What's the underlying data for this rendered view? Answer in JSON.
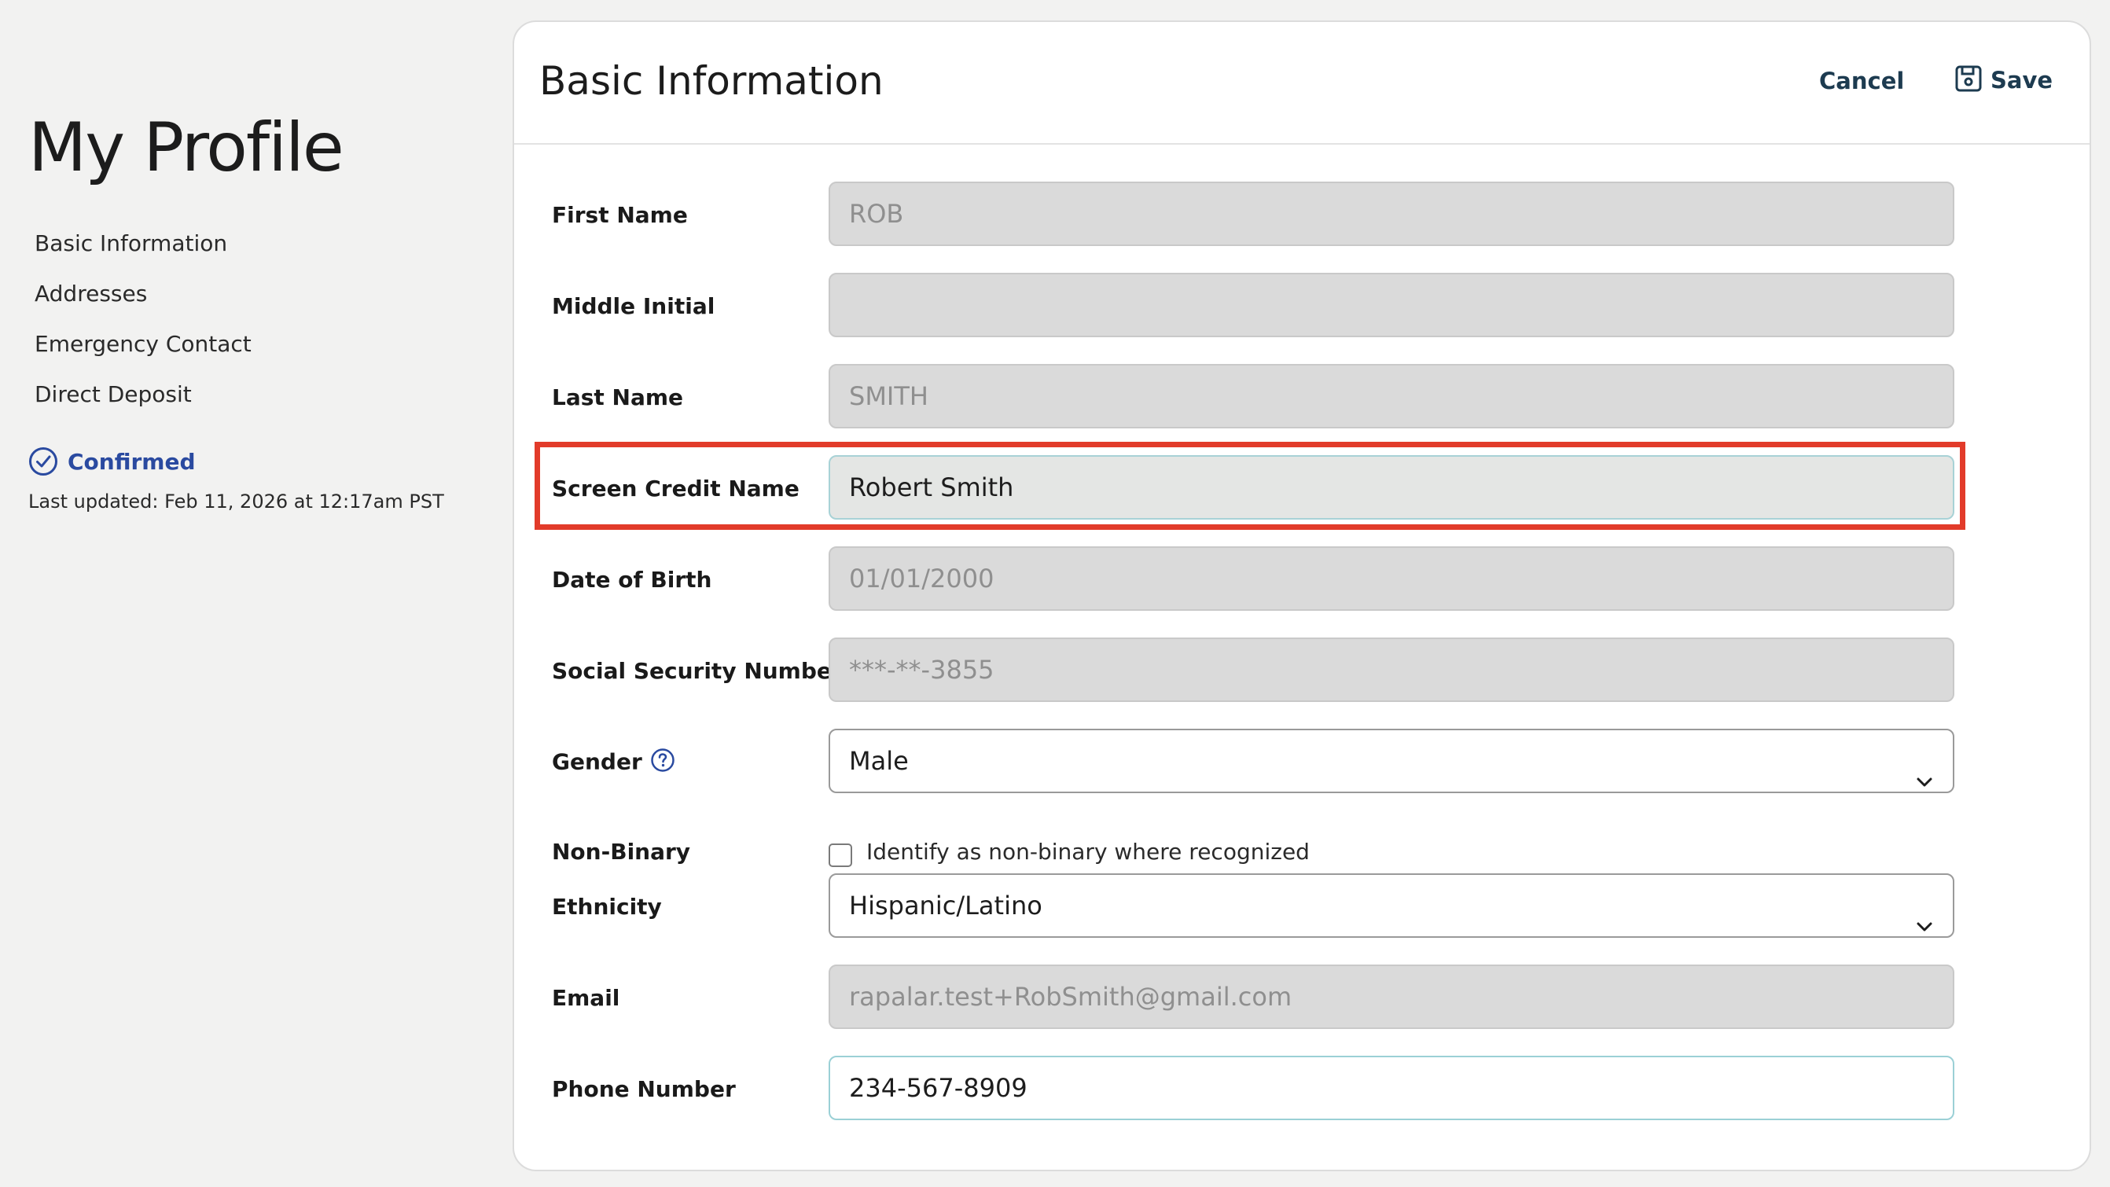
{
  "sidebar": {
    "title": "My Profile",
    "nav": [
      {
        "label": "Basic Information"
      },
      {
        "label": "Addresses"
      },
      {
        "label": "Emergency Contact"
      },
      {
        "label": "Direct Deposit"
      }
    ],
    "status": "Confirmed",
    "last_updated": "Last updated: Feb 11, 2026 at 12:17am PST"
  },
  "card": {
    "title": "Basic Information",
    "cancel_label": "Cancel",
    "save_label": "Save"
  },
  "form": {
    "first_name": {
      "label": "First Name",
      "value": "ROB"
    },
    "middle_initial": {
      "label": "Middle Initial",
      "value": ""
    },
    "last_name": {
      "label": "Last Name",
      "value": "SMITH"
    },
    "screen_credit_name": {
      "label": "Screen Credit Name",
      "value": "Robert Smith"
    },
    "date_of_birth": {
      "label": "Date of Birth",
      "value": "01/01/2000"
    },
    "ssn": {
      "label": "Social Security Number",
      "value": "***-**-3855"
    },
    "gender": {
      "label": "Gender",
      "value": "Male"
    },
    "non_binary": {
      "label": "Non-Binary",
      "checkbox_label": "Identify as non-binary where recognized",
      "checked": false
    },
    "ethnicity": {
      "label": "Ethnicity",
      "value": "Hispanic/Latino"
    },
    "email": {
      "label": "Email",
      "value": "rapalar.test+RobSmith@gmail.com"
    },
    "phone": {
      "label": "Phone Number",
      "value": "234-567-8909"
    }
  },
  "colors": {
    "accent_blue": "#2a4aa0",
    "button_text": "#1d3b50",
    "highlight_red": "#e23b2a",
    "focus_teal": "#9bd0d6"
  },
  "icons": {
    "status": "check-circle-icon",
    "save": "floppy-disk-icon",
    "help": "question-circle-icon",
    "dropdown": "chevron-down-icon"
  }
}
